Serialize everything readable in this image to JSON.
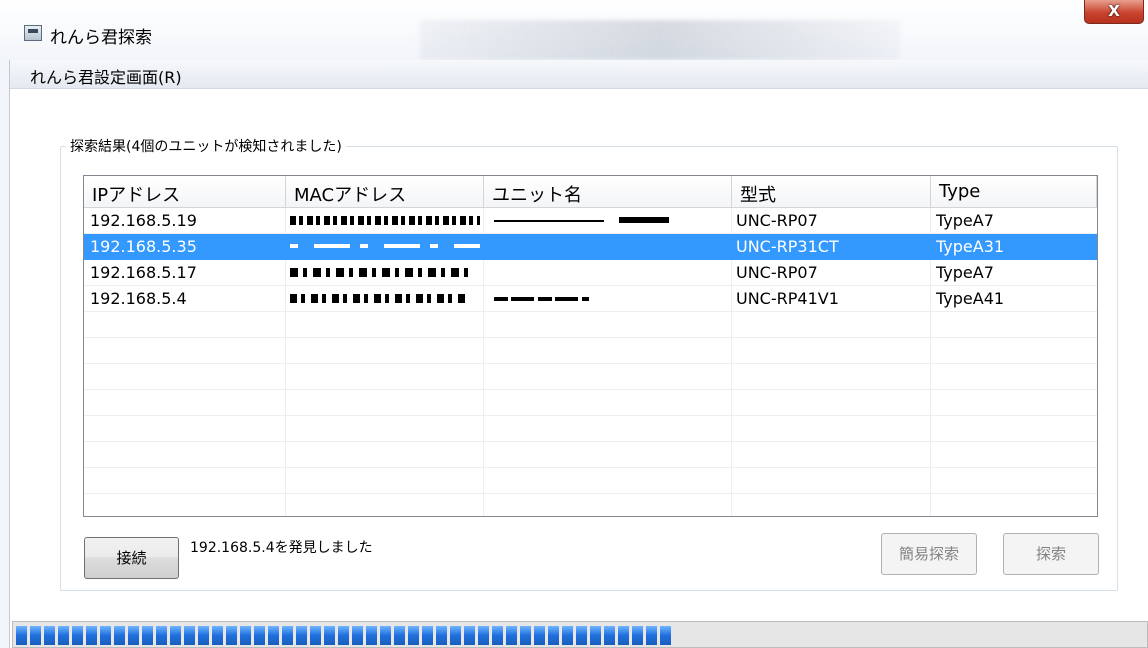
{
  "window": {
    "title": "れんら君探索",
    "close_label": "X"
  },
  "menu": {
    "items": [
      {
        "label": "れんら君設定画面(R)"
      }
    ]
  },
  "group": {
    "label": "探索結果(4個のユニットが検知されました)"
  },
  "table": {
    "columns": [
      "IPアドレス",
      "MACアドレス",
      "ユニット名",
      "型式",
      "Type"
    ],
    "rows": [
      {
        "ip": "192.168.5.19",
        "model": "UNC-RP07",
        "type": "TypeA7",
        "selected": false
      },
      {
        "ip": "192.168.5.35",
        "model": "UNC-RP31CT",
        "type": "TypeA31",
        "selected": true
      },
      {
        "ip": "192.168.5.17",
        "model": "UNC-RP07",
        "type": "TypeA7",
        "selected": false
      },
      {
        "ip": "192.168.5.4",
        "model": "UNC-RP41V1",
        "type": "TypeA41",
        "selected": false
      }
    ]
  },
  "buttons": {
    "connect": "接続",
    "simple_search": "簡易探索",
    "search": "探索"
  },
  "status": {
    "text": "192.168.5.4を発見しました"
  },
  "progress": {
    "fraction": 0.58
  },
  "colors": {
    "selection": "#3399ff",
    "progress": "#1f6fdc",
    "close": "#c9442f"
  }
}
